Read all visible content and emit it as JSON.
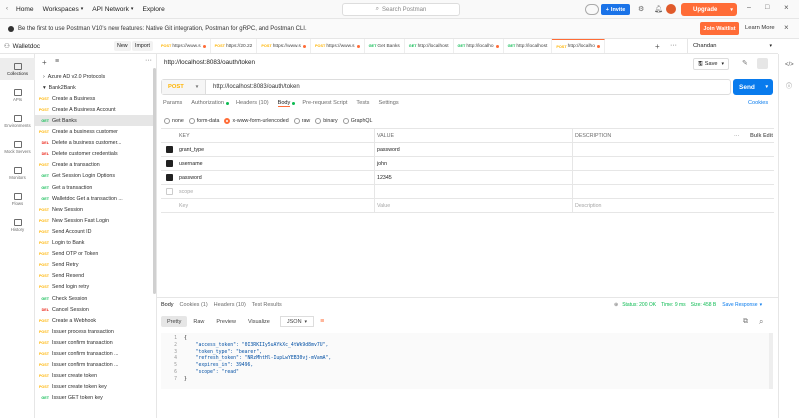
{
  "titlebar": {
    "home": "Home",
    "workspaces": "Workspaces",
    "api_network": "API Network",
    "explore": "Explore",
    "search_placeholder": "Search Postman",
    "invite": "Invite",
    "upgrade": "Upgrade"
  },
  "banner": {
    "text": "Be the first to use Postman V10's new features: Native Git integration, Postman for gRPC, and Postman CLI.",
    "join": "Join Waitlist",
    "learn": "Learn More"
  },
  "workspace": {
    "name": "Walletdoc",
    "new": "New",
    "import": "Import"
  },
  "tabs": [
    {
      "method": "POST",
      "label": "https://www.s",
      "dot": true
    },
    {
      "method": "POST",
      "label": "https://20.22",
      "dot": false
    },
    {
      "method": "POST",
      "label": "https://www.s",
      "dot": true
    },
    {
      "method": "POST",
      "label": "https://www.s",
      "dot": true
    },
    {
      "method": "GET",
      "label": "Get Banks",
      "dot": false
    },
    {
      "method": "GET",
      "label": "http://localhost",
      "dot": false
    },
    {
      "method": "GET",
      "label": "http://localho",
      "dot": true
    },
    {
      "method": "GET",
      "label": "http://localhost",
      "dot": false
    },
    {
      "method": "POST",
      "label": "http://localho",
      "dot": true
    }
  ],
  "env": "Chandan",
  "rail": [
    "Collections",
    "APIs",
    "Environments",
    "Mock Servers",
    "Monitors",
    "Flows",
    "History"
  ],
  "sidebar": [
    {
      "type": "folder",
      "label": "Azure AD v2.0 Protocols",
      "open": false
    },
    {
      "type": "folder",
      "label": "Bank2Bank",
      "open": true
    },
    {
      "method": "POST",
      "label": "Create a Business"
    },
    {
      "method": "POST",
      "label": "Create A Business Account"
    },
    {
      "method": "GET",
      "label": "Get Banks",
      "selected": true
    },
    {
      "method": "POST",
      "label": "Create a business customer"
    },
    {
      "method": "DEL",
      "label": "Delete a business customer..."
    },
    {
      "method": "DEL",
      "label": "Delete customer credentials"
    },
    {
      "method": "POST",
      "label": "Create a transaction"
    },
    {
      "method": "GET",
      "label": "Get Session Login Options"
    },
    {
      "method": "GET",
      "label": "Get a transaction"
    },
    {
      "method": "GET",
      "label": "Walletdoc Get a transaction ..."
    },
    {
      "method": "POST",
      "label": "New Session"
    },
    {
      "method": "POST",
      "label": "New Session Fast Login"
    },
    {
      "method": "POST",
      "label": "Send Account ID"
    },
    {
      "method": "POST",
      "label": "Login to Bank"
    },
    {
      "method": "POST",
      "label": "Send OTP or Token"
    },
    {
      "method": "POST",
      "label": "Send Retry"
    },
    {
      "method": "POST",
      "label": "Send Resend"
    },
    {
      "method": "POST",
      "label": "Send login retry"
    },
    {
      "method": "GET",
      "label": "Check Session"
    },
    {
      "method": "DEL",
      "label": "Cancel Session"
    },
    {
      "method": "POST",
      "label": "Create a Webhook"
    },
    {
      "method": "POST",
      "label": "Issuer process transaction"
    },
    {
      "method": "POST",
      "label": "Issuer confirm transaction"
    },
    {
      "method": "POST",
      "label": "Issuer confirm transaction ..."
    },
    {
      "method": "POST",
      "label": "Issuer confirm transaction ..."
    },
    {
      "method": "POST",
      "label": "Issuer create token"
    },
    {
      "method": "POST",
      "label": "Issuer create token key"
    },
    {
      "method": "GET",
      "label": "Issuer GET token key"
    }
  ],
  "request": {
    "title": "http://localhost:8083/oauth/token",
    "save": "Save",
    "method": "POST",
    "url": "http://localhost:8083/oauth/token",
    "send": "Send",
    "tabs": [
      "Params",
      "Authorization",
      "Headers (10)",
      "Body",
      "Pre-request Script",
      "Tests",
      "Settings"
    ],
    "cookies": "Cookies",
    "body_options": [
      "none",
      "form-data",
      "x-www-form-urlencoded",
      "raw",
      "binary",
      "GraphQL"
    ],
    "columns": [
      "KEY",
      "VALUE",
      "DESCRIPTION"
    ],
    "bulk_edit": "Bulk Edit",
    "rows": [
      {
        "key": "grant_type",
        "value": "password",
        "checked": true
      },
      {
        "key": "username",
        "value": "john",
        "checked": true
      },
      {
        "key": "password",
        "value": "12345",
        "checked": true
      },
      {
        "key": "scope",
        "value": "",
        "checked": false,
        "placeholder": true
      }
    ],
    "placeholders": {
      "key": "Key",
      "value": "Value",
      "description": "Description"
    }
  },
  "response": {
    "tabs": [
      "Body",
      "Cookies (1)",
      "Headers (10)",
      "Test Results"
    ],
    "status": "Status: 200 OK",
    "time": "Time: 9 ms",
    "size": "Size: 458 B",
    "save": "Save Response",
    "formats": [
      "Pretty",
      "Raw",
      "Preview",
      "Visualize"
    ],
    "lang": "JSON",
    "lines": [
      "{",
      "    \"access_token\": \"0I3RKIIy5uAYkXc_4tWk9d8mv7U\",",
      "    \"token_type\": \"bearer\",",
      "    \"refresh_token\": \"NRzMhtHl-IupLwYEB30vj-mVamA\",",
      "    \"expires_in\": 39496,",
      "    \"scope\": \"read\"",
      "}"
    ]
  },
  "colors": {
    "accent": "#ff6c37",
    "send": "#097bed",
    "get": "#0cbb52",
    "post": "#ffb400",
    "delete": "#eb2013"
  }
}
